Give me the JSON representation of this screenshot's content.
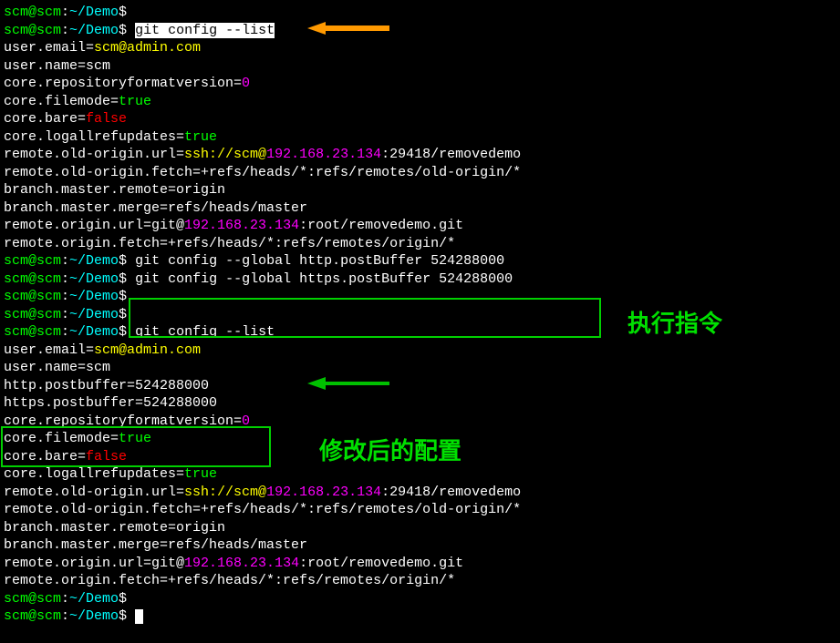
{
  "prompt": {
    "user": "scm@scm",
    "path": "~/Demo",
    "sep1": ":",
    "sep2": "$"
  },
  "commands": {
    "cmd1": "git config --list",
    "cmd2": " git config --global http.postBuffer 524288000",
    "cmd3": " git config --global https.postBuffer 524288000",
    "cmd4": " git config --list"
  },
  "config": {
    "email_key": "user.email=",
    "email_val": "scm@admin.com",
    "name": "user.name=scm",
    "repofmt_key": "core.repositoryformatversion=",
    "repofmt_val": "0",
    "filemode_key": "core.filemode=",
    "filemode_val": "true",
    "bare_key": "core.bare=",
    "bare_val": "false",
    "logall_key": "core.logallrefupdates=",
    "logall_val": "true",
    "oldurl_pre": "remote.old-origin.url=",
    "oldurl_ssh": "ssh://scm@",
    "oldurl_ip": "192.168.23.134",
    "oldurl_post": ":29418/removedemo",
    "oldfetch": "remote.old-origin.fetch=+refs/heads/*:refs/remotes/old-origin/*",
    "branch_remote": "branch.master.remote=origin",
    "branch_merge": "branch.master.merge=refs/heads/master",
    "originurl_pre": "remote.origin.url=git@",
    "originurl_ip": "192.168.23.134",
    "originurl_post": ":root/removedemo.git",
    "originfetch": "remote.origin.fetch=+refs/heads/*:refs/remotes/origin/*",
    "httpbuf": "http.postbuffer=524288000",
    "httpsbuf": "https.postbuffer=524288000"
  },
  "annotations": {
    "label1": "执行指令",
    "label2": "修改后的配置"
  }
}
